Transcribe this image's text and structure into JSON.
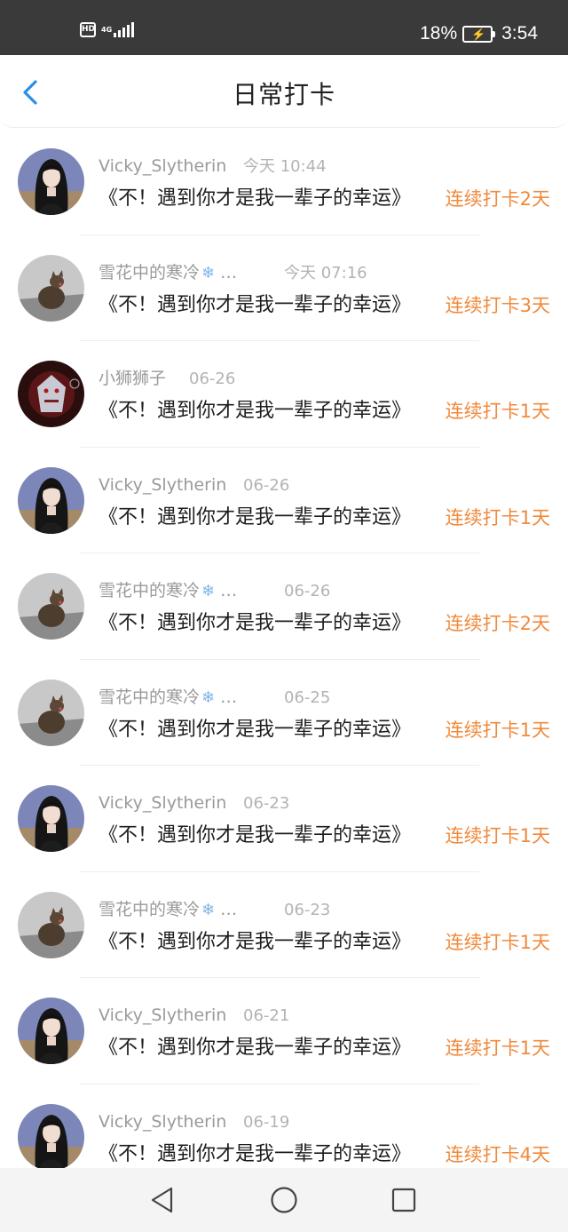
{
  "status_bar": {
    "hd": "HD",
    "network": "4G",
    "battery_percent": "18%",
    "time": "3:54"
  },
  "header": {
    "title": "日常打卡",
    "back_icon": "chevron-left-icon"
  },
  "colors": {
    "streak": "#f08a3c",
    "back": "#2a8ee8"
  },
  "items": [
    {
      "name": "Vicky_Slytherin",
      "time": "今天 10:44",
      "message": "《不！遇到你才是我一辈子的幸运》",
      "streak": "连续打卡2天",
      "avatar": "girl-avatar"
    },
    {
      "name": "雪花中的寒冷",
      "snow": true,
      "time": "今天 07:16",
      "message": "《不！遇到你才是我一辈子的幸运》",
      "streak": "连续打卡3天",
      "avatar": "cat-avatar"
    },
    {
      "name": "小狮狮子",
      "time": "06-26",
      "message": "《不！遇到你才是我一辈子的幸运》",
      "streak": "连续打卡1天",
      "avatar": "dark-avatar"
    },
    {
      "name": "Vicky_Slytherin",
      "time": "06-26",
      "message": "《不！遇到你才是我一辈子的幸运》",
      "streak": "连续打卡1天",
      "avatar": "girl-avatar"
    },
    {
      "name": "雪花中的寒冷",
      "snow": true,
      "time": "06-26",
      "message": "《不！遇到你才是我一辈子的幸运》",
      "streak": "连续打卡2天",
      "avatar": "cat-avatar"
    },
    {
      "name": "雪花中的寒冷",
      "snow": true,
      "time": "06-25",
      "message": "《不！遇到你才是我一辈子的幸运》",
      "streak": "连续打卡1天",
      "avatar": "cat-avatar"
    },
    {
      "name": "Vicky_Slytherin",
      "time": "06-23",
      "message": "《不！遇到你才是我一辈子的幸运》",
      "streak": "连续打卡1天",
      "avatar": "girl-avatar"
    },
    {
      "name": "雪花中的寒冷",
      "snow": true,
      "time": "06-23",
      "message": "《不！遇到你才是我一辈子的幸运》",
      "streak": "连续打卡1天",
      "avatar": "cat-avatar"
    },
    {
      "name": "Vicky_Slytherin",
      "time": "06-21",
      "message": "《不！遇到你才是我一辈子的幸运》",
      "streak": "连续打卡1天",
      "avatar": "girl-avatar"
    },
    {
      "name": "Vicky_Slytherin",
      "time": "06-19",
      "message": "《不！遇到你才是我一辈子的幸运》",
      "streak": "连续打卡4天",
      "avatar": "girl-avatar"
    }
  ],
  "nav": {
    "back": "triangle-back-icon",
    "home": "circle-home-icon",
    "recents": "square-recents-icon"
  }
}
